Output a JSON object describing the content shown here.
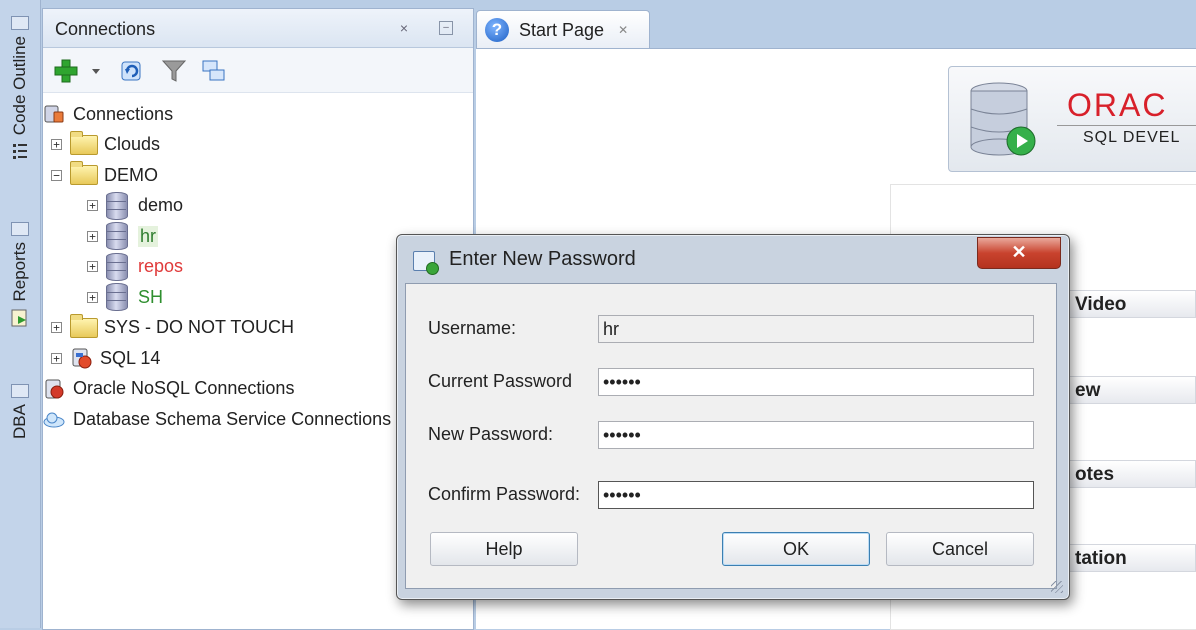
{
  "side_tabs": [
    {
      "label": "Code Outline"
    },
    {
      "label": "Reports"
    },
    {
      "label": "DBA"
    }
  ],
  "connections_panel": {
    "title": "Connections",
    "tree": {
      "root": "Connections",
      "clouds": "Clouds",
      "demo": "DEMO",
      "demo_children": [
        "demo",
        "hr",
        "repos",
        "SH"
      ],
      "sys": "SYS - DO NOT TOUCH",
      "sql14": "SQL 14",
      "nosql": "Oracle NoSQL Connections",
      "schema_service": "Database Schema Service Connections"
    },
    "colors": {
      "hr": "#2f7d2f",
      "repos": "#e03a3a",
      "sh": "#2f8f2f"
    }
  },
  "editor": {
    "tab_label": "Start Page",
    "banner_brand": "ORAC",
    "banner_sub": "SQL DEVEL",
    "start_rows": [
      "Video",
      "ew",
      "otes",
      "tation"
    ]
  },
  "dialog": {
    "title": "Enter New Password",
    "close_glyph": "✕",
    "fields": {
      "username_label": "Username:",
      "username_value": "hr",
      "current_label": "Current Password",
      "current_value": "••••••",
      "new_label": "New Password:",
      "new_value": "••••••",
      "confirm_label": "Confirm Password:",
      "confirm_value": "••••••"
    },
    "buttons": {
      "help": "Help",
      "ok": "OK",
      "cancel": "Cancel"
    }
  }
}
